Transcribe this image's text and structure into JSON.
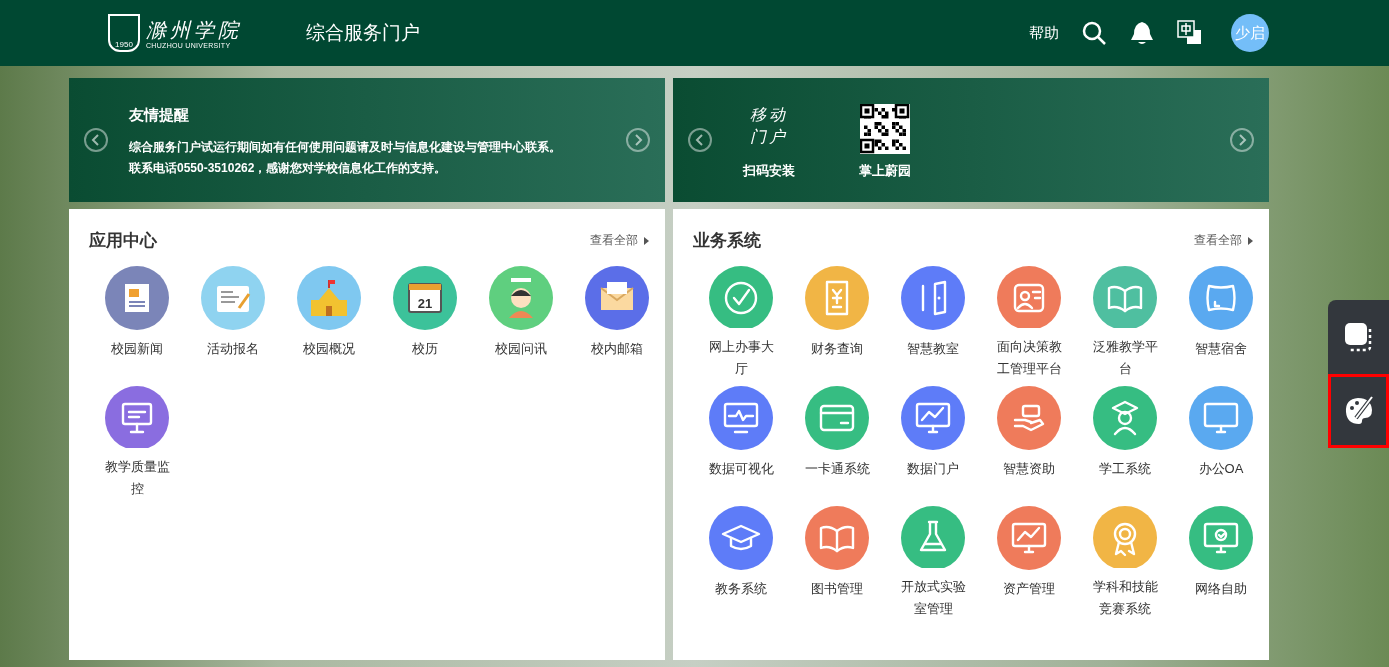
{
  "header": {
    "logo": {
      "name": "滁州学院",
      "english": "CHUZHOU UNIVERSITY",
      "year": "1950"
    },
    "title": "综合服务门户",
    "help": "帮助",
    "avatar": "少启"
  },
  "notice": {
    "title": "友情提醒",
    "lines": [
      "综合服务门户试运行期间如有任何使用问题请及时与信息化建设与管理中心联系。",
      "联系电话0550-3510262，感谢您对学校信息化工作的支持。"
    ]
  },
  "mobile": {
    "art": "移动门户",
    "items": [
      {
        "kind": "art",
        "label": "扫码安装"
      },
      {
        "kind": "qr",
        "label": "掌上蔚园"
      }
    ]
  },
  "apps": {
    "title": "应用中心",
    "more": "查看全部",
    "items": [
      {
        "label": "校园新闻",
        "color": "#7b85b8",
        "kind": "news"
      },
      {
        "label": "活动报名",
        "color": "#8fd3f0",
        "kind": "form"
      },
      {
        "label": "校园概况",
        "color": "#7fc8f0",
        "kind": "school"
      },
      {
        "label": "校历",
        "color": "#3cc29a",
        "kind": "calendar",
        "badge": "21"
      },
      {
        "label": "校园问讯",
        "color": "#5fcf7f",
        "kind": "person"
      },
      {
        "label": "校内邮箱",
        "color": "#5b6ee8",
        "kind": "mail"
      },
      {
        "label": "教学质量监控",
        "color": "#8a6de0",
        "kind": "board"
      }
    ]
  },
  "systems": {
    "title": "业务系统",
    "more": "查看全部",
    "items": [
      {
        "label": "网上办事大厅",
        "color": "#36bd82",
        "kind": "check"
      },
      {
        "label": "财务查询",
        "color": "#f1b545",
        "kind": "receipt"
      },
      {
        "label": "智慧教室",
        "color": "#5e7cf8",
        "kind": "door"
      },
      {
        "label": "面向决策教工管理平台",
        "color": "#ef7b5b",
        "kind": "idcard"
      },
      {
        "label": "泛雅教学平台",
        "color": "#4fbfa0",
        "kind": "book"
      },
      {
        "label": "智慧宿舍",
        "color": "#5aa9f0",
        "kind": "pillow"
      },
      {
        "label": "数据可视化",
        "color": "#5e7cf8",
        "kind": "pulse"
      },
      {
        "label": "一卡通系统",
        "color": "#36bd82",
        "kind": "card"
      },
      {
        "label": "数据门户",
        "color": "#5e7cf8",
        "kind": "chart"
      },
      {
        "label": "智慧资助",
        "color": "#ef7b5b",
        "kind": "hand"
      },
      {
        "label": "学工系统",
        "color": "#36bd82",
        "kind": "graduate"
      },
      {
        "label": "办公OA",
        "color": "#5aa9f0",
        "kind": "monitor"
      },
      {
        "label": "教务系统",
        "color": "#5e7cf8",
        "kind": "cap"
      },
      {
        "label": "图书管理",
        "color": "#ef7b5b",
        "kind": "book"
      },
      {
        "label": "开放式实验室管理",
        "color": "#36bd82",
        "kind": "flask"
      },
      {
        "label": "资产管理",
        "color": "#ef7b5b",
        "kind": "chart"
      },
      {
        "label": "学科和技能竞赛系统",
        "color": "#f1b545",
        "kind": "medal"
      },
      {
        "label": "网络自助",
        "color": "#36bd82",
        "kind": "tick"
      }
    ]
  },
  "side_tools": [
    {
      "kind": "layers",
      "highlighted": false
    },
    {
      "kind": "palette",
      "highlighted": true
    }
  ]
}
